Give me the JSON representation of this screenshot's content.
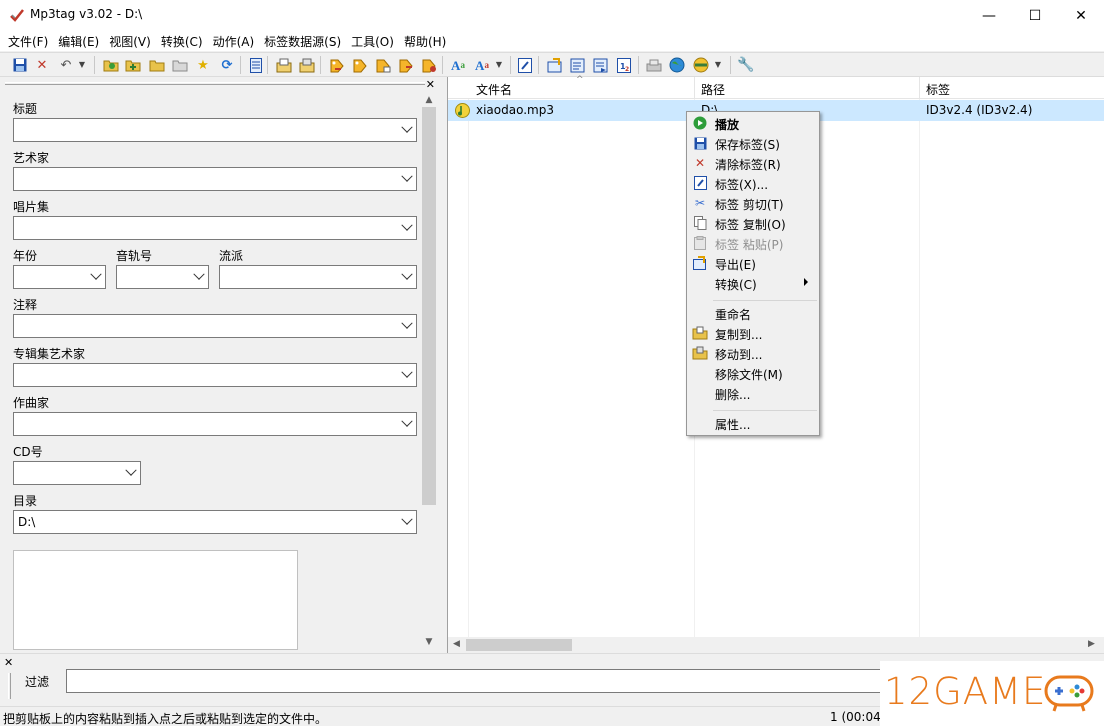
{
  "window": {
    "title": "Mp3tag v3.02  -  D:\\",
    "minimize_glyph": "—",
    "maximize_glyph": "☐",
    "close_glyph": "✕"
  },
  "menubar": [
    "文件(F)",
    "编辑(E)",
    "视图(V)",
    "转换(C)",
    "动作(A)",
    "标签数据源(S)",
    "工具(O)",
    "帮助(H)"
  ],
  "toolbar": {
    "icons": [
      "save-icon",
      "remove-tag-icon",
      "undo-icon",
      "undo-dropdown-icon",
      "change-directory-icon",
      "add-directory-icon",
      "open-folder-icon",
      "favorites-folder-icon",
      "star-icon",
      "refresh-icon",
      "list-icon",
      "copy-tag-icon",
      "paste-tag-icon",
      "tag-filename-icon",
      "filename-tag-icon",
      "text-tag-icon",
      "tag-tag-icon",
      "autonumber-icon",
      "actions-icon",
      "actions-dropdown-icon",
      "extended-tags-icon",
      "export-icon",
      "playlist-icon",
      "playlist2-icon",
      "numbering-icon",
      "cover-icon",
      "web-source-icon",
      "web-source-dropdown-icon",
      "options-icon"
    ]
  },
  "tag_panel": {
    "close_glyph": "✕",
    "fields": {
      "title_label": "标题",
      "artist_label": "艺术家",
      "album_label": "唱片集",
      "year_label": "年份",
      "track_label": "音轨号",
      "genre_label": "流派",
      "comment_label": "注释",
      "album_artist_label": "专辑集艺术家",
      "composer_label": "作曲家",
      "disc_label": "CD号",
      "directory_label": "目录",
      "directory_value": "D:\\"
    }
  },
  "file_list": {
    "columns": [
      "文件名",
      "路径",
      "标签"
    ],
    "rows": [
      {
        "filename": "xiaodao.mp3",
        "path": "D:\\",
        "tag": "ID3v2.4 (ID3v2.4)"
      }
    ]
  },
  "context_menu": {
    "items": [
      {
        "label": "播放",
        "icon": "play-icon",
        "bold": true
      },
      {
        "label": "保存标签(S)",
        "icon": "save-icon"
      },
      {
        "label": "清除标签(R)",
        "icon": "remove-icon"
      },
      {
        "label": "标签(X)...",
        "icon": "extended-tags-icon"
      },
      {
        "label": "标签 剪切(T)",
        "icon": "cut-icon"
      },
      {
        "label": "标签 复制(O)",
        "icon": "copy-icon"
      },
      {
        "label": "标签 粘贴(P)",
        "icon": "paste-icon",
        "disabled": true
      },
      {
        "label": "导出(E)",
        "icon": "export-icon"
      },
      {
        "label": "转换(C)",
        "icon": "",
        "submenu": true
      },
      {
        "label": "重命名",
        "icon": ""
      },
      {
        "label": "复制到...",
        "icon": "copy-folder-icon"
      },
      {
        "label": "移动到...",
        "icon": "move-folder-icon"
      },
      {
        "label": "移除文件(M)",
        "icon": ""
      },
      {
        "label": "删除...",
        "icon": ""
      },
      {
        "label": "属性...",
        "icon": ""
      }
    ]
  },
  "filter": {
    "close_glyph": "✕",
    "label": "过滤",
    "value": ""
  },
  "statusbar": {
    "message": "把剪贴板上的内容粘贴到插入点之后或粘贴到选定的文件中。",
    "count": "1 (00:04:"
  },
  "watermark": {
    "text": "12GAME"
  },
  "colors": {
    "selection": "#cce8ff",
    "watermark_orange": "#e87a1d"
  }
}
